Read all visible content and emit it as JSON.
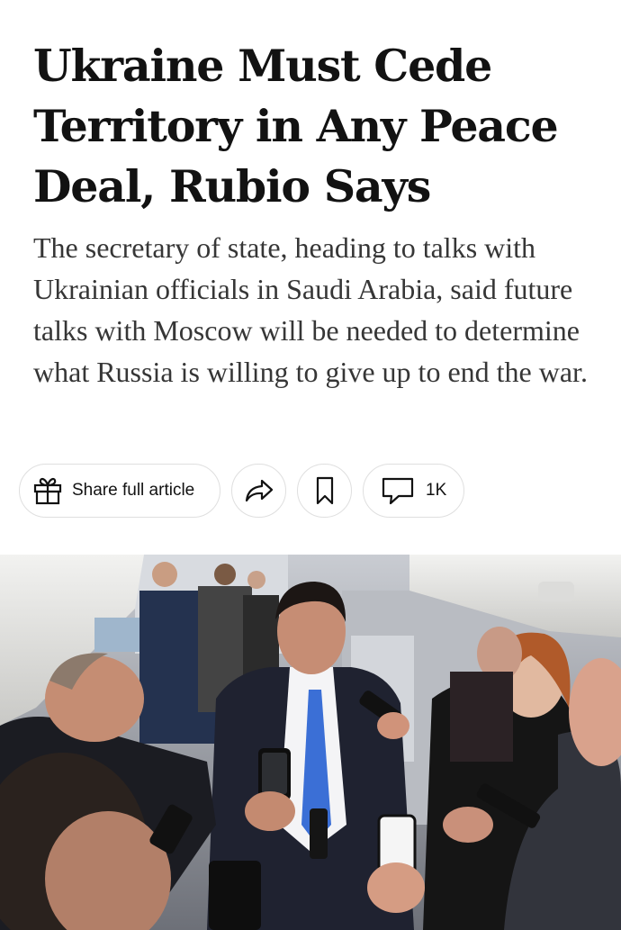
{
  "article": {
    "headline": "Ukraine Must Cede Territory in Any Peace Deal, Rubio Says",
    "summary": "The secretary of state, heading to talks with Ukrainian officials in Saudi Arabia, said future talks with Moscow will be needed to determine what Russia is willing to give up to end the war."
  },
  "actions": {
    "share_full_label": "Share full article",
    "comments_count": "1K",
    "icons": {
      "share_full": "gift-icon",
      "share": "share-arrow-icon",
      "save": "bookmark-icon",
      "comments": "comment-bubble-icon"
    }
  },
  "photo": {
    "description_icon": "news-photo"
  },
  "colors": {
    "text": "#121212",
    "summary_text": "#363636",
    "pill_border": "#dfdfdf",
    "background": "#ffffff"
  }
}
